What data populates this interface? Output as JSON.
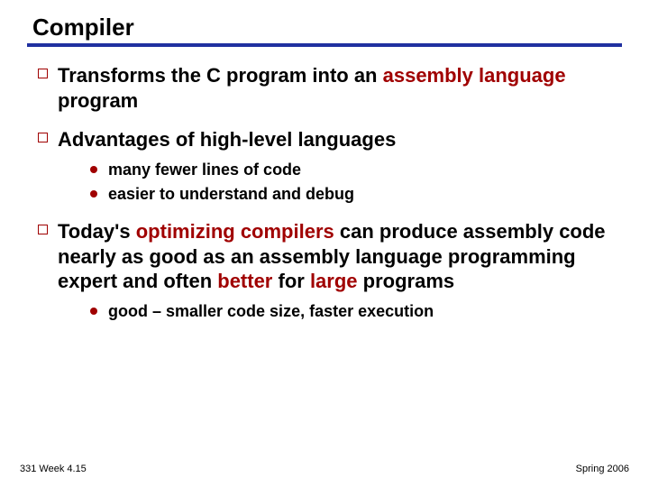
{
  "title": "Compiler",
  "items": {
    "a": {
      "pre": "Transforms the C program into an ",
      "hl": "assembly language",
      "post": " program"
    },
    "b": {
      "text": "Advantages of high-level languages",
      "sub": {
        "s1": "many fewer lines of code",
        "s2": "easier to understand and debug"
      }
    },
    "c": {
      "p1": "Today's ",
      "h1": "optimizing compilers",
      "p2": " can produce assembly code nearly as good as an assembly language programming expert and often ",
      "h2": "better",
      "p3": " for ",
      "h3": "large",
      "p4": " programs",
      "sub": {
        "s1": "good – smaller code size, faster execution"
      }
    }
  },
  "footer": {
    "left": "331 Week 4.15",
    "right": "Spring 2006"
  }
}
